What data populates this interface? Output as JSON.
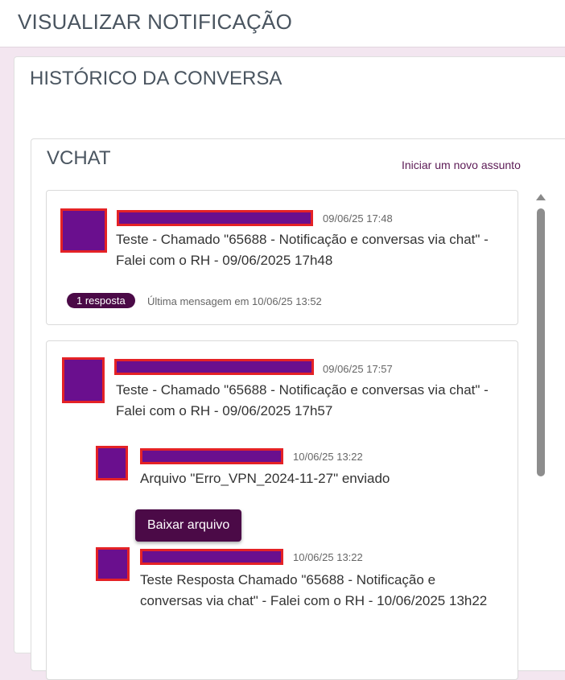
{
  "page": {
    "title": "VISUALIZAR NOTIFICAÇÃO"
  },
  "history": {
    "title": "HISTÓRICO DA CONVERSA"
  },
  "vchat": {
    "title": "VCHAT",
    "new_topic_label": "Iniciar um novo assunto",
    "threads": [
      {
        "time": "09/06/25 17:48",
        "message": "Teste - Chamado \"65688 - Notificação e conversas via chat\" - Falei com o RH - 09/06/2025 17h48",
        "reply_badge": "1 resposta",
        "last_message": "Última mensagem em 10/06/25 13:52"
      },
      {
        "time": "09/06/25 17:57",
        "message": "Teste - Chamado \"65688 - Notificação e conversas via chat\" - Falei com o RH - 09/06/2025 17h57",
        "replies": [
          {
            "time": "10/06/25 13:22",
            "message": "Arquivo \"Erro_VPN_2024-11-27\" enviado",
            "download_label": "Baixar arquivo"
          },
          {
            "time": "10/06/25 13:22",
            "message": "Teste Resposta Chamado \"65688 - Notificação e conversas via chat\" - Falei com o RH - 10/06/2025 13h22"
          }
        ]
      }
    ]
  },
  "colors": {
    "accent": "#4b0a47",
    "avatar_fill": "#6a0f8e",
    "redaction_border": "#e42226",
    "background": "#f3e6f0"
  }
}
